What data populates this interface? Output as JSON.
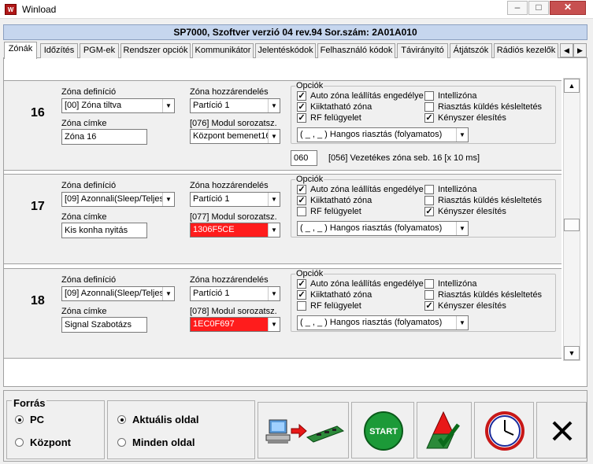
{
  "window": {
    "title": "Winload",
    "app_icon": "W"
  },
  "header": {
    "text": "SP7000, Szoftver verzió 04 rev.94 Sor.szám: 2A01A010"
  },
  "tabs": [
    {
      "label": "Zónák",
      "active": true
    },
    {
      "label": "Időzítés"
    },
    {
      "label": "PGM-ek"
    },
    {
      "label": "Rendszer opciók"
    },
    {
      "label": "Kommunikátor"
    },
    {
      "label": "Jelentéskódok"
    },
    {
      "label": "Felhasználó kódok"
    },
    {
      "label": "Távirányító"
    },
    {
      "label": "Átjátszók"
    },
    {
      "label": "Rádiós kezelők"
    }
  ],
  "labels": {
    "zone_def": "Zóna definíció",
    "zone_label": "Zóna címke",
    "partition_assign": "Zóna hozzárendelés",
    "options": "Opciók",
    "opt_auto": "Auto zóna leállítás engedélye",
    "opt_bypass": "Kiiktatható zóna",
    "opt_rf": "RF felügyelet",
    "opt_intelli": "Intellizóna",
    "opt_delay": "Riasztás küldés késleltetés",
    "opt_force": "Kényszer élesítés",
    "alarm_type": "( _ , _ ) Hangos riasztás (folyamatos)"
  },
  "zones": [
    {
      "number": "16",
      "definition": "[00] Zóna tiltva",
      "label": "Zóna 16",
      "partition": "Partíció 1",
      "module_label": "[076] Modul sorozatsz.",
      "module_value": "Központ bemenet16",
      "module_red": false,
      "opts": {
        "auto": true,
        "bypass": true,
        "rf": true,
        "intelli": false,
        "delay": false,
        "force": true
      },
      "extra_value": "060",
      "extra_label": "[056] Vezetékes zóna seb. 16 [x 10 ms]"
    },
    {
      "number": "17",
      "definition": "[09] Azonnali(Sleep/Teljes",
      "label": "Kis konha nyitás",
      "partition": "Partíció 1",
      "module_label": "[077] Modul sorozatsz.",
      "module_value": "1306F5CE",
      "module_red": true,
      "opts": {
        "auto": true,
        "bypass": true,
        "rf": false,
        "intelli": false,
        "delay": false,
        "force": true
      }
    },
    {
      "number": "18",
      "definition": "[09] Azonnali(Sleep/Teljes",
      "label": "Signal Szabotázs",
      "partition": "Partíció 1",
      "module_label": "[078] Modul sorozatsz.",
      "module_value": "1EC0F697",
      "module_red": true,
      "opts": {
        "auto": true,
        "bypass": true,
        "rf": false,
        "intelli": false,
        "delay": false,
        "force": true
      }
    }
  ],
  "bottom": {
    "source_title": "Forrás",
    "source_pc": "PC",
    "source_panel": "Központ",
    "page_current": "Aktuális oldal",
    "page_all": "Minden oldal",
    "start_label": "START",
    "icons": [
      "transfer-pc-to-board-icon",
      "start-icon",
      "send-icon",
      "clock-icon",
      "close-x-icon"
    ]
  }
}
